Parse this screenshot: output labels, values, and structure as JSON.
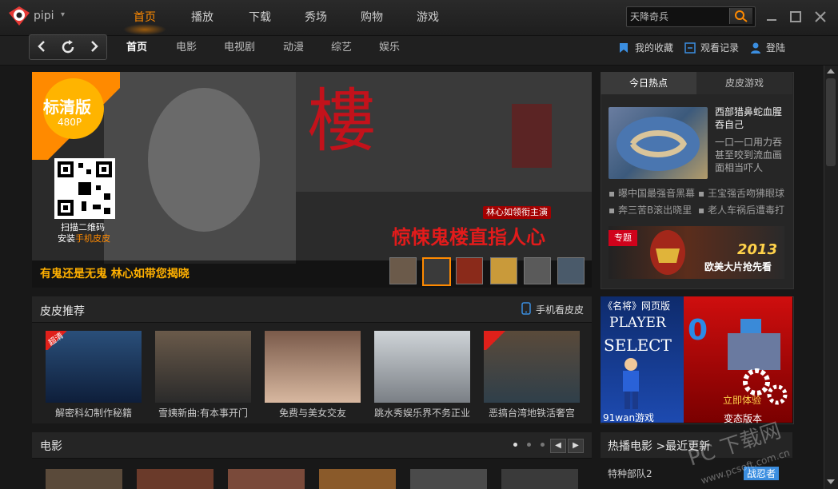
{
  "app": {
    "brand": "pipi"
  },
  "top_tabs": [
    "首页",
    "播放",
    "下载",
    "秀场",
    "购物",
    "游戏"
  ],
  "search": {
    "value": "天降奇兵"
  },
  "sub_tabs": [
    "首页",
    "电影",
    "电视剧",
    "动漫",
    "综艺",
    "娱乐"
  ],
  "sub_links": {
    "favorites": "我的收藏",
    "history": "观看记录",
    "login": "登陆"
  },
  "banner": {
    "badge_title": "标清版",
    "badge_sub": "480P",
    "qr_line1": "扫描二维码",
    "qr_line2_prefix": "安装",
    "qr_line2_highlight": "手机皮皮",
    "big_char": "樓",
    "tagline_small": "林心如领衔主演",
    "tagline_big": "惊悚鬼楼直指人心",
    "caption": "有鬼还是无鬼 林心如带您揭晓"
  },
  "right_panel": {
    "tabs": [
      "今日热点",
      "皮皮游戏"
    ],
    "feature_title": "西部猎鼻蛇血腥吞自己",
    "feature_desc": "一口一口用力吞甚至咬到流血画面相当吓人",
    "links_left": [
      "曝中国最强音黑幕",
      "奔三苦B滚出晓里"
    ],
    "links_right": [
      "王宝强舌吻狒眼球",
      "老人车祸后遭毒打"
    ],
    "ad_tag": "专题",
    "ad_year": "2013",
    "ad_text": "欧美大片抢先看"
  },
  "pipi_recommend": {
    "title": "皮皮推荐",
    "mobile_link": "手机看皮皮",
    "items": [
      "解密科幻制作秘籍",
      "雪姨新曲:有本事开门",
      "免费与美女交友",
      "跳水秀娱乐界不务正业",
      "恶搞台湾地铁活奢宫"
    ],
    "hd_tag": "超清"
  },
  "game_ad": {
    "title": "《名将》网页版",
    "select_text": [
      "PLAYER",
      "SELECT"
    ],
    "site": "91wan游戏",
    "try": "立即体验",
    "caption": "变态版本",
    "score": "0"
  },
  "movie_section": {
    "title": "电影"
  },
  "hot_movies": {
    "title": "热播电影 >最近更新",
    "item1": "特种部队2",
    "item2": "战忍者"
  },
  "watermark": {
    "main": "PC 下载网",
    "url": "www.pcsoft.com.cn"
  }
}
